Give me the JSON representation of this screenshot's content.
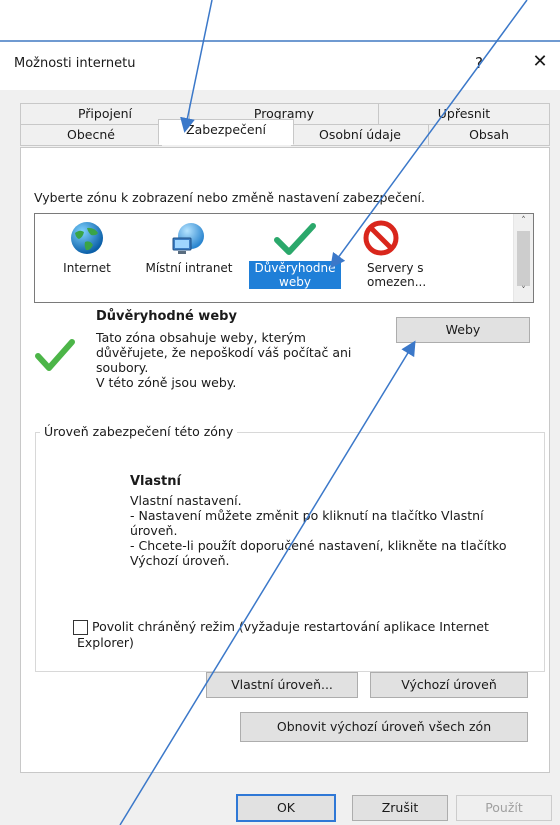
{
  "window": {
    "title": "Možnosti internetu",
    "help_label": "?",
    "close_label": "✕"
  },
  "tabs": {
    "row1": [
      "Připojení",
      "Programy",
      "Upřesnit"
    ],
    "row2": [
      "Obecné",
      "Zabezpečení",
      "Osobní údaje",
      "Obsah"
    ],
    "active": "Zabezpečení"
  },
  "zone_section": {
    "instruction": "Vyberte zónu k zobrazení nebo změně nastavení zabezpečení.",
    "zones": [
      {
        "label_line1": "Internet",
        "label_line2": "",
        "icon": "globe-icon"
      },
      {
        "label_line1": "Místní intranet",
        "label_line2": "",
        "icon": "intranet-icon"
      },
      {
        "label_line1": "Důvěryhodné",
        "label_line2": "weby",
        "icon": "checkmark-icon",
        "selected": true
      },
      {
        "label_line1": "Servery s",
        "label_line2": "omezen...",
        "icon": "no-entry-icon"
      }
    ],
    "scroll_up": "˄",
    "scroll_down": "˅"
  },
  "zone_details": {
    "title": "Důvěryhodné weby",
    "description_lines": [
      "Tato zóna obsahuje weby, kterým",
      "důvěřujete, že nepoškodí váš počítač ani",
      "soubory.",
      "V této zóně jsou weby."
    ],
    "sites_button": "Weby"
  },
  "security_level": {
    "legend": "Úroveň zabezpečení této zóny",
    "title": "Vlastní",
    "lines": [
      "Vlastní nastavení.",
      "- Nastavení můžete změnit po kliknutí na tlačítko Vlastní",
      "úroveň.",
      "- Chcete-li použít doporučené nastavení, klikněte na tlačítko",
      "Výchozí úroveň."
    ],
    "protected_mode_line1": "Povolit chráněný režim (vyžaduje restartování aplikace Internet",
    "protected_mode_line2": "Explorer)",
    "protected_mode_checked": false,
    "custom_level_button": "Vlastní úroveň...",
    "default_level_button": "Výchozí úroveň"
  },
  "reset_all_button": "Obnovit výchozí úroveň všech zón",
  "footer": {
    "ok": "OK",
    "cancel": "Zrušit",
    "apply": "Použít"
  },
  "colors": {
    "selection": "#1f7fd8",
    "annotation_arrow": "#3b78c9"
  }
}
